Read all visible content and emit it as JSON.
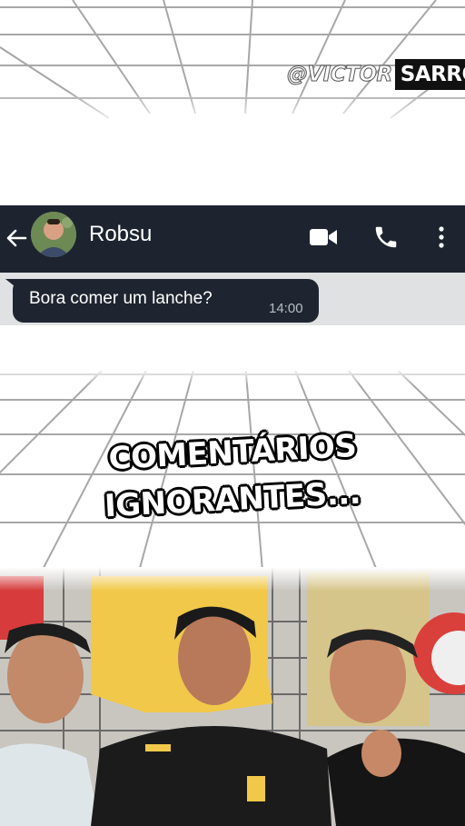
{
  "watermark": {
    "part1": "@VICTOR",
    "part2": "SARRO"
  },
  "chat": {
    "contact_name": "Robsu",
    "message": {
      "text": "Bora comer um lanche?",
      "time": "14:00"
    },
    "colors": {
      "header_bg": "#1d2430",
      "bubble_bg": "#1f2530",
      "message_area_bg": "#dfe1e3"
    },
    "icons": [
      "back-arrow-icon",
      "video-call-icon",
      "phone-icon",
      "more-options-icon"
    ]
  },
  "caption": {
    "line1": "COMENTÁRIOS",
    "line2": "IGNORANTES..."
  }
}
